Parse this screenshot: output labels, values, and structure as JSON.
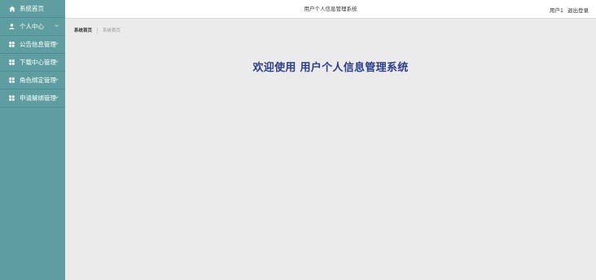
{
  "sidebar": {
    "brand": {
      "label": "系统首页",
      "icon": "home-icon"
    },
    "items": [
      {
        "label": "个人中心",
        "icon": "user-icon"
      },
      {
        "label": "公告信息管理",
        "icon": "grid-icon"
      },
      {
        "label": "下载中心管理",
        "icon": "grid-icon"
      },
      {
        "label": "角色绑定管理",
        "icon": "grid-icon"
      },
      {
        "label": "申请解绑管理",
        "icon": "grid-icon"
      }
    ]
  },
  "header": {
    "title": "用户个人信息管理系统",
    "user": "用户1",
    "logout": "退出登录"
  },
  "breadcrumb": {
    "home": "系统首页",
    "current": "系统首页"
  },
  "main": {
    "welcome": "欢迎使用 用户个人信息管理系统"
  },
  "colors": {
    "sidebar_bg": "#5f9ea0",
    "welcome_text": "#2a3f8c",
    "content_bg": "#ebebeb"
  }
}
